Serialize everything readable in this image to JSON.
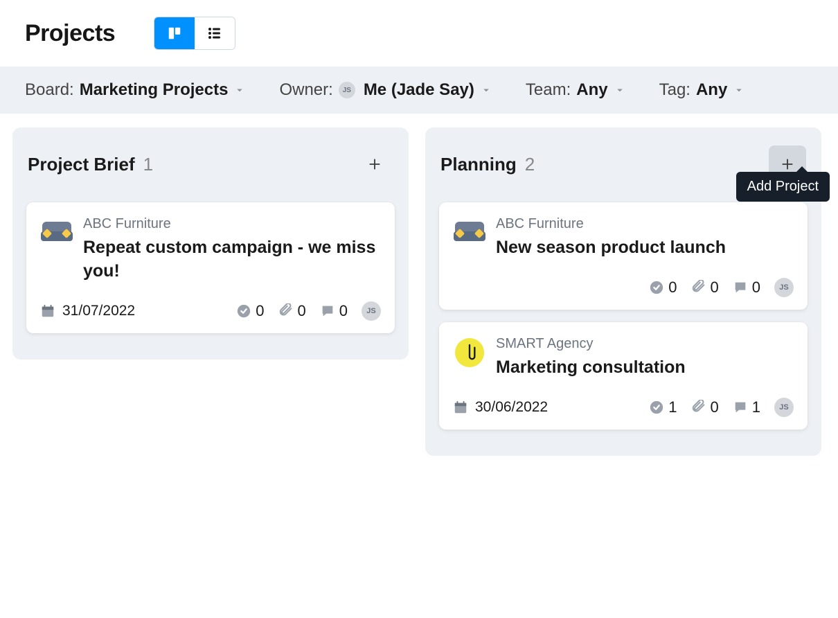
{
  "page": {
    "title": "Projects"
  },
  "filters": {
    "board": {
      "label": "Board:",
      "value": "Marketing Projects"
    },
    "owner": {
      "label": "Owner:",
      "value": "Me (Jade Say)",
      "avatar_initials": "JS"
    },
    "team": {
      "label": "Team:",
      "value": "Any"
    },
    "tag": {
      "label": "Tag:",
      "value": "Any"
    }
  },
  "tooltip": {
    "add_project": "Add Project"
  },
  "columns": [
    {
      "title": "Project Brief",
      "count": "1",
      "cards": [
        {
          "icon": "sofa-icon",
          "subtitle": "ABC Furniture",
          "title": "Repeat custom campaign - we miss you!",
          "due_date": "31/07/2022",
          "tasks": "0",
          "attachments": "0",
          "comments": "0",
          "assignee_initials": "JS"
        }
      ]
    },
    {
      "title": "Planning",
      "count": "2",
      "add_hover": true,
      "cards": [
        {
          "icon": "sofa-icon",
          "subtitle": "ABC Furniture",
          "title": "New season product launch",
          "due_date": "",
          "tasks": "0",
          "attachments": "0",
          "comments": "0",
          "assignee_initials": "JS"
        },
        {
          "icon": "paperclip-icon",
          "subtitle": "SMART Agency",
          "title": "Marketing consultation",
          "due_date": "30/06/2022",
          "tasks": "1",
          "attachments": "0",
          "comments": "1",
          "assignee_initials": "JS"
        }
      ]
    }
  ]
}
